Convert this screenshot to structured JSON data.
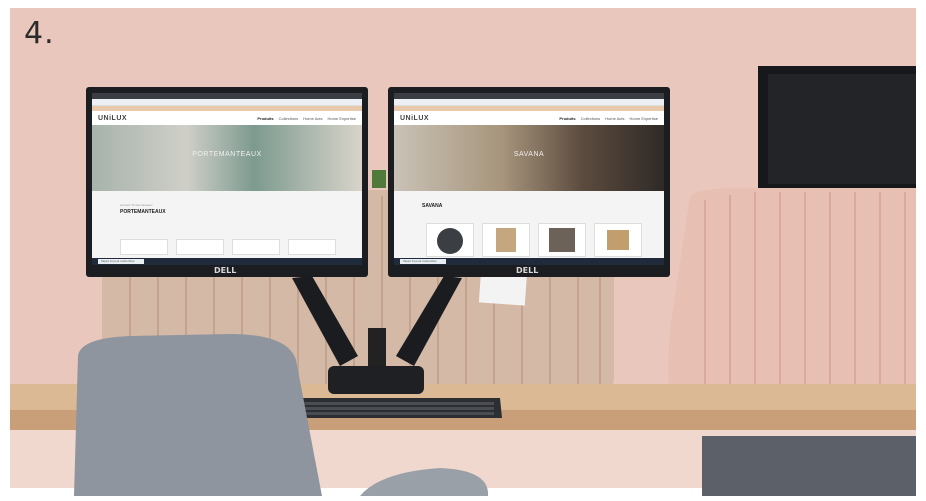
{
  "step": {
    "label": "4."
  },
  "left_screen": {
    "logo": "UNiLUX",
    "menu": [
      "Produits",
      "Collections",
      "Home Acts",
      "Home Expertise"
    ],
    "hero_title": "PORTEMANTEAUX",
    "breadcrumb": "Accueil / Portemanteaux",
    "category_title": "PORTEMANTEAUX",
    "taskbar_search": "Tapez ici pour rechercher"
  },
  "right_screen": {
    "logo": "UNiLUX",
    "menu": [
      "Produits",
      "Collections",
      "Home Acts",
      "Home Expertise"
    ],
    "hero_title": "SAVANA",
    "category_title": "SAVANA",
    "taskbar_search": "Tapez ici pour rechercher"
  },
  "monitor_brand": "DELL",
  "colors": {
    "wall": "#e9c7bd",
    "desk": "#d8b58f",
    "panel": "#c9b19c",
    "pink_panel": "#e7bfb3",
    "chair": "#8e959e"
  }
}
